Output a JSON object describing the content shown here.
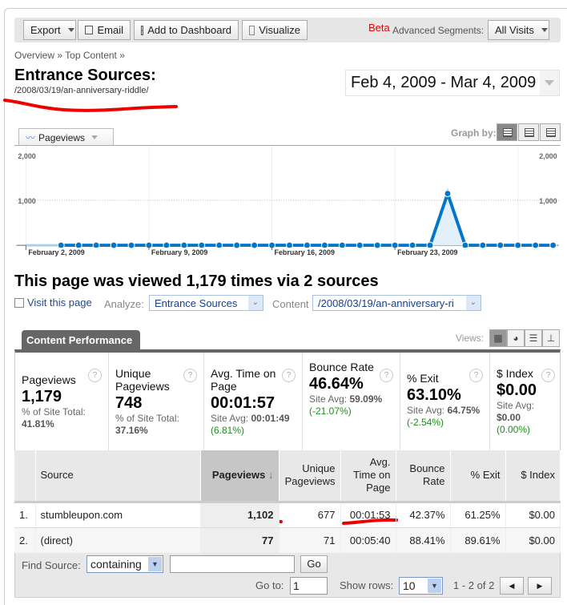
{
  "toolbar": {
    "export": "Export",
    "email": "Email",
    "add_dashboard": "Add to Dashboard",
    "visualize": "Visualize",
    "beta": "Beta",
    "segments_label": "Advanced Segments:",
    "segments_value": "All Visits"
  },
  "breadcrumb": {
    "overview": "Overview",
    "sep": "»",
    "top_content": "Top Content"
  },
  "title": "Entrance Sources:",
  "page_path": "/2008/03/19/an-anniversary-riddle/",
  "date_range": "Feb 4, 2009 - Mar 4, 2009",
  "graph": {
    "metric": "Pageviews",
    "graph_by": "Graph by:"
  },
  "chart_data": {
    "type": "line",
    "series": [
      {
        "name": "Pageviews",
        "x": [
          "2009-02-04",
          "2009-02-05",
          "2009-02-06",
          "2009-02-07",
          "2009-02-08",
          "2009-02-09",
          "2009-02-10",
          "2009-02-11",
          "2009-02-12",
          "2009-02-13",
          "2009-02-14",
          "2009-02-15",
          "2009-02-16",
          "2009-02-17",
          "2009-02-18",
          "2009-02-19",
          "2009-02-20",
          "2009-02-21",
          "2009-02-22",
          "2009-02-23",
          "2009-02-24",
          "2009-02-25",
          "2009-02-26",
          "2009-02-27",
          "2009-02-28",
          "2009-03-01",
          "2009-03-02",
          "2009-03-03",
          "2009-03-04"
        ],
        "values": [
          1,
          1,
          1,
          1,
          1,
          1,
          1,
          1,
          1,
          1,
          1,
          1,
          1,
          1,
          1,
          1,
          1,
          1,
          1,
          1,
          1,
          0,
          1150,
          0,
          1,
          1,
          1,
          1,
          1
        ]
      }
    ],
    "x_tick_labels": [
      "February 2, 2009",
      "February 9, 2009",
      "February 16, 2009",
      "February 23, 2009"
    ],
    "y_tick_labels": [
      "1,000",
      "2,000"
    ],
    "ylim": [
      0,
      2000
    ],
    "grid": true,
    "colors": {
      "line": "#0077cc",
      "fill": "#e3f0fa"
    }
  },
  "summary": "This page was viewed 1,179 times via 2 sources",
  "controls": {
    "visit": "Visit this page",
    "analyze_label": "Analyze:",
    "analyze_value": "Entrance Sources",
    "content_label": "Content",
    "content_value": "/2008/03/19/an-anniversary-ri"
  },
  "panel": {
    "tab": "Content Performance",
    "views": "Views:"
  },
  "scorecards": [
    {
      "title": "Pageviews",
      "value": "1,179",
      "sub": "% of Site Total:",
      "avg": "41.81%",
      "diff": ""
    },
    {
      "title": "Unique Pageviews",
      "value": "748",
      "sub": "% of Site Total:",
      "avg": "37.16%",
      "diff": ""
    },
    {
      "title": "Avg. Time on Page",
      "value": "00:01:57",
      "sub": "Site Avg:",
      "avg": "00:01:49",
      "diff": "(6.81%)"
    },
    {
      "title": "Bounce Rate",
      "value": "46.64%",
      "sub": "Site Avg:",
      "avg": "59.09%",
      "diff": "(-21.07%)"
    },
    {
      "title": "% Exit",
      "value": "63.10%",
      "sub": "Site Avg:",
      "avg": "64.75%",
      "diff": "(-2.54%)"
    },
    {
      "title": "$ Index",
      "value": "$0.00",
      "sub": "Site Avg:",
      "avg": "$0.00",
      "diff": "(0.00%)"
    }
  ],
  "table": {
    "headers": [
      "Source",
      "Pageviews",
      "Unique Pageviews",
      "Avg. Time on Page",
      "Bounce Rate",
      "% Exit",
      "$ Index"
    ],
    "rows": [
      [
        "1.",
        "stumbleupon.com",
        "1,102",
        "677",
        "00:01:53",
        "42.37%",
        "61.25%",
        "$0.00"
      ],
      [
        "2.",
        "(direct)",
        "77",
        "71",
        "00:05:40",
        "88.41%",
        "89.61%",
        "$0.00"
      ]
    ]
  },
  "footer": {
    "find_label": "Find Source:",
    "find_mode": "containing",
    "find_value": "",
    "go": "Go",
    "goto_label": "Go to:",
    "goto_value": "1",
    "rows_label": "Show rows:",
    "rows_value": "10",
    "range": "1 - 2 of 2"
  }
}
